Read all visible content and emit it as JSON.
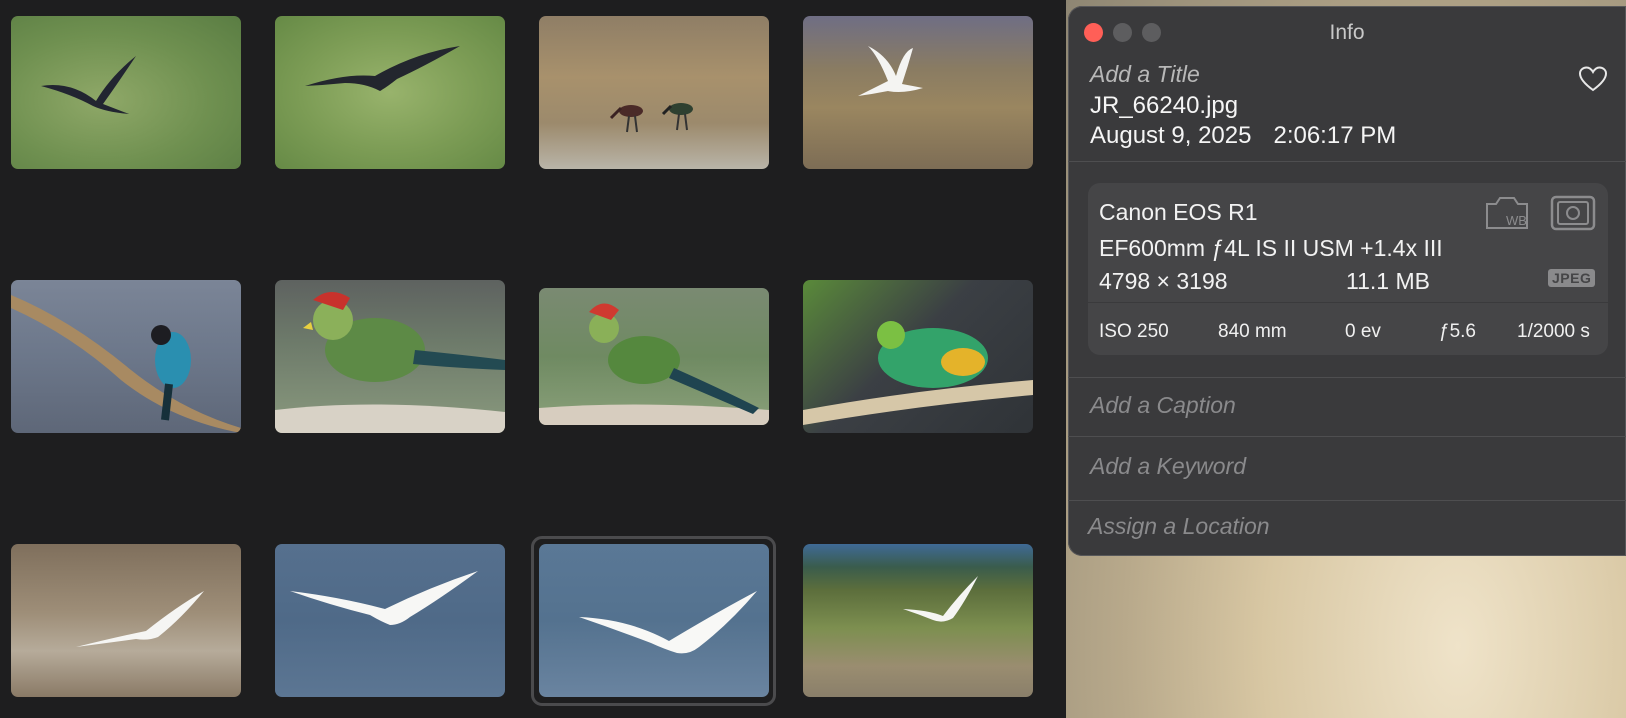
{
  "panel": {
    "title": "Info",
    "title_placeholder": "Add a Title",
    "filename": "JR_66240.jpg",
    "date": "August 9, 2025",
    "time": "2:06:17 PM",
    "camera": "Canon EOS R1",
    "lens": "EF600mm ƒ4L IS II USM +1.4x III",
    "dimensions": "4798 × 3198",
    "file_size": "11.1 MB",
    "format_badge": "JPEG",
    "exif": {
      "iso": "ISO 250",
      "focal_length": "840 mm",
      "exposure_bias": "0 ev",
      "aperture": "ƒ5.6",
      "shutter": "1/2000 s"
    },
    "caption_placeholder": "Add a Caption",
    "keyword_placeholder": "Add a Keyword",
    "location_placeholder": "Assign a Location"
  },
  "icons": [
    "close-icon",
    "minimize-icon",
    "zoom-icon",
    "heart-icon",
    "white-balance-icon",
    "metering-icon"
  ],
  "colors": {
    "window_bg": "#1e1e1f",
    "panel_bg": "#3a3a3c",
    "close_light": "#ff5f57"
  }
}
